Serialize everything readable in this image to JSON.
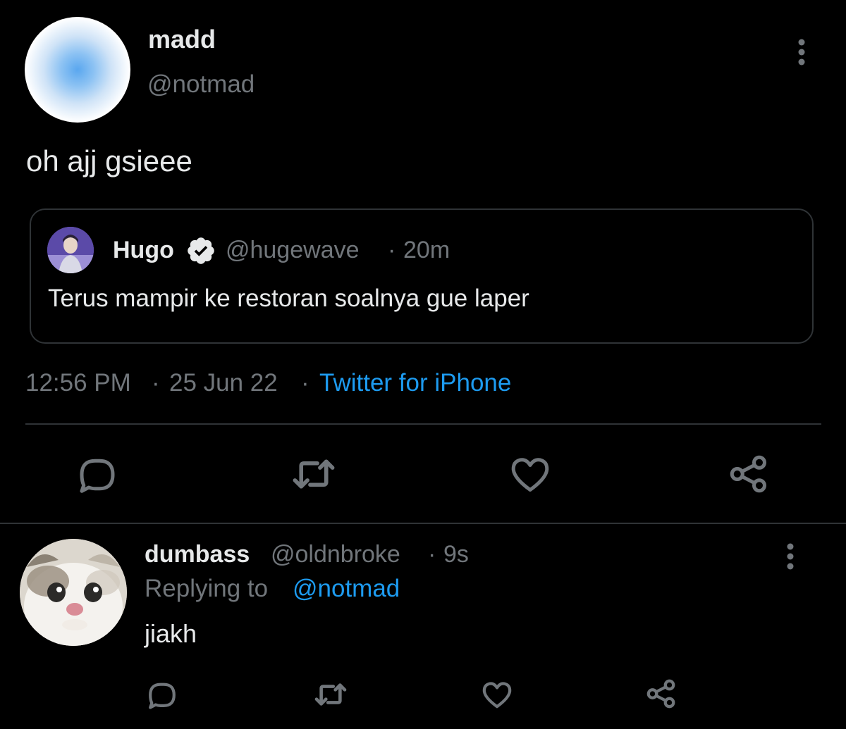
{
  "main_tweet": {
    "display_name": "madd",
    "handle": "@notmad",
    "text": "oh ajj gsieee",
    "more_icon": "more-vertical-icon",
    "quoted": {
      "display_name": "Hugo",
      "verified_icon": "verified-badge-icon",
      "handle": "@hugewave",
      "separator": "·",
      "time": "20m",
      "text": "Terus mampir ke restoran soalnya gue laper"
    },
    "meta": {
      "time": "12:56 PM",
      "separator": "·",
      "date": "25 Jun 22",
      "source": "Twitter for iPhone"
    },
    "actions": [
      {
        "name": "reply",
        "icon": "reply-icon"
      },
      {
        "name": "retweet",
        "icon": "retweet-icon"
      },
      {
        "name": "like",
        "icon": "heart-icon"
      },
      {
        "name": "share",
        "icon": "share-icon"
      }
    ]
  },
  "reply_tweet": {
    "display_name": "dumbass",
    "handle": "@oldnbroke",
    "separator": "·",
    "time": "9s",
    "replying_label": "Replying to",
    "replying_mention": "@notmad",
    "text": "jiakh",
    "more_icon": "more-vertical-icon",
    "actions": [
      {
        "name": "reply",
        "icon": "reply-icon"
      },
      {
        "name": "retweet",
        "icon": "retweet-icon"
      },
      {
        "name": "like",
        "icon": "heart-icon"
      },
      {
        "name": "share",
        "icon": "share-icon"
      }
    ]
  },
  "colors": {
    "background": "#000000",
    "primary_text": "#e7e9ea",
    "secondary_text": "#71767b",
    "accent": "#1d9bf0",
    "border": "#2f3336",
    "icon": "#71767b"
  }
}
